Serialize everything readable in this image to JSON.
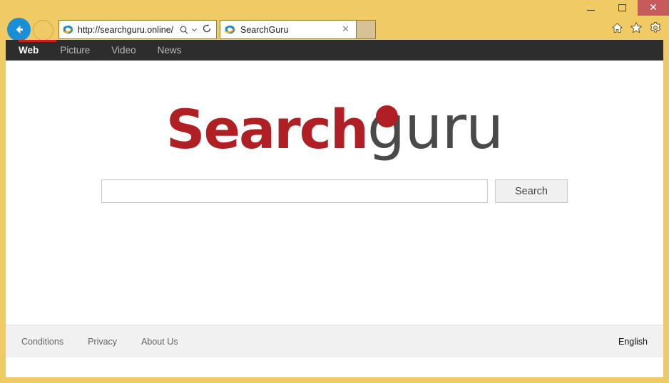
{
  "browser": {
    "window_controls": {
      "minimize": "minimize-button",
      "maximize": "maximize-button",
      "close_label": "✕"
    },
    "back_button_icon": "back-arrow-icon",
    "forward_button_icon": "forward-arrow-icon",
    "address": {
      "url": "http://searchguru.online/",
      "site_icon": "internet-explorer-icon",
      "search_dropdown_icon": "search-dropdown-icon",
      "refresh_icon": "refresh-icon"
    },
    "tabs": [
      {
        "title": "SearchGuru",
        "icon": "internet-explorer-icon",
        "close_label": "✕",
        "active": true
      }
    ],
    "new_tab_button": "new-tab-button",
    "toolbar_icons": [
      "home-icon",
      "favorites-star-icon",
      "settings-gear-icon"
    ]
  },
  "site": {
    "nav": {
      "items": [
        {
          "label": "Web",
          "active": true
        },
        {
          "label": "Picture",
          "active": false
        },
        {
          "label": "Video",
          "active": false
        },
        {
          "label": "News",
          "active": false
        }
      ],
      "active_marker_color": "#cc1f1f",
      "background_color": "#2d2d2d"
    },
    "logo": {
      "part1": "Search",
      "part2": "guru",
      "part1_color": "#b01f24",
      "part2_color": "#4a4a4a",
      "dot_color": "#b01f24"
    },
    "search": {
      "value": "",
      "placeholder": "",
      "button_label": "Search"
    },
    "footer": {
      "links": [
        "Conditions",
        "Privacy",
        "About Us"
      ],
      "language": "English"
    }
  }
}
